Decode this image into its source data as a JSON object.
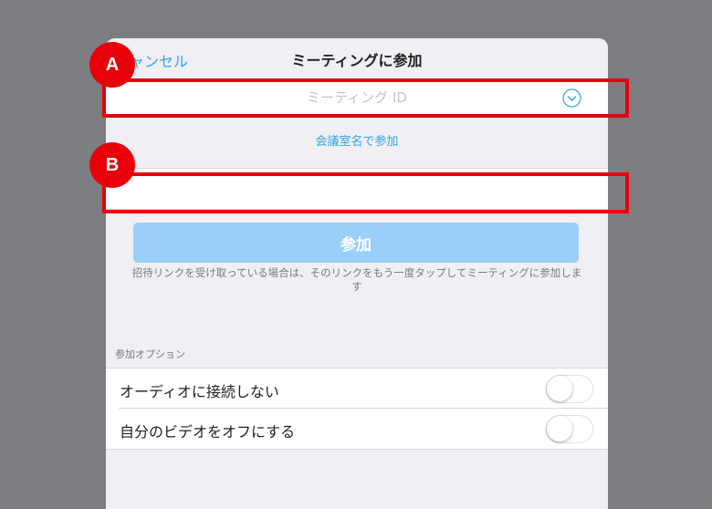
{
  "nav": {
    "cancel_label": "キャンセル",
    "title": "ミーティングに参加"
  },
  "meeting_id": {
    "placeholder": "ミーティング ID",
    "value": "",
    "dropdown_icon": "chevron-down-circle-icon"
  },
  "room_link": "会議室名で参加",
  "name_field": {
    "value": ""
  },
  "join_button_label": "参加",
  "hint_text": "招待リンクを受け取っている場合は、そのリンクをもう一度タップしてミーティングに参加します",
  "options": {
    "section_label": "参加オプション",
    "items": [
      {
        "label": "オーディオに接続しない",
        "enabled": false
      },
      {
        "label": "自分のビデオをオフにする",
        "enabled": false
      }
    ]
  },
  "annotations": {
    "a_label": "A",
    "b_label": "B",
    "color": "#e8000b"
  },
  "colors": {
    "accent": "#2ea5e6",
    "join_button": "#9acffa",
    "backdrop": "#7d7e82",
    "sheet_bg": "#efeff4"
  }
}
